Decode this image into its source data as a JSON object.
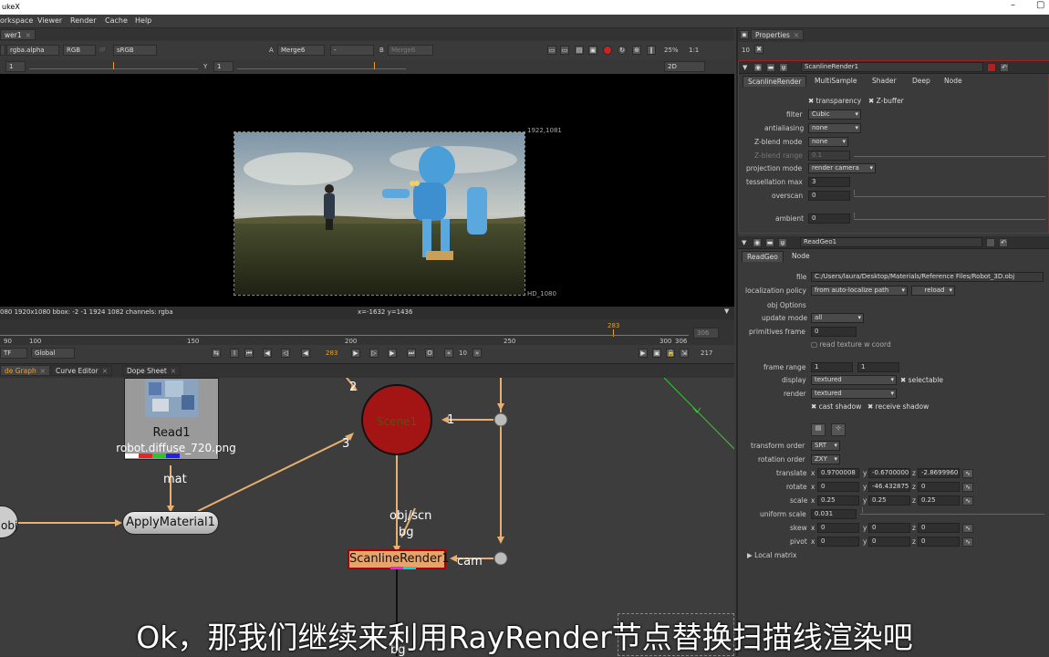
{
  "app": {
    "title": "ukeX"
  },
  "menu": [
    "orkspace",
    "Viewer",
    "Render",
    "Cache",
    "Help"
  ],
  "viewer": {
    "tab": "wer1",
    "channels": "rgba.alpha",
    "rgb": "RGB",
    "ip": "IP",
    "colorspace": "sRGB",
    "a_label": "A",
    "a_input": "Merge6",
    "dash": "-",
    "b_label": "B",
    "b_input": "Merge6",
    "zoom": "25%",
    "ratio": "1:1",
    "view_mode": "2D",
    "y_label": "Y",
    "gain_val": "1",
    "gamma_val": "1",
    "format_top": "1922,1081",
    "format_bottom": "HD_1080",
    "status": "080 1920x1080  bbox: -2 -1 1924 1082 channels: rgba",
    "coords": "x=-1632 y=1436",
    "timeline_ticks": [
      "90",
      "100",
      "150",
      "200",
      "250",
      "300",
      "306"
    ],
    "current_frame_top": "283",
    "end_frame": "306",
    "tf": "TF",
    "global": "Global",
    "current_frame": "283",
    "step": "10",
    "frame_count": "217"
  },
  "nodegraph": {
    "tabs": [
      "de Graph",
      "Curve Editor",
      "Dope Sheet"
    ],
    "nodes": {
      "read_title": "Read1",
      "read_file": "robot.diffuse_720.png",
      "mat_label": "mat",
      "applymaterial": "ApplyMaterial1",
      "obj_label": "obj",
      "scene": "Scene1",
      "scene_in1": "1",
      "scene_in2": "2",
      "scene_in3": "3",
      "objscn": "obj/scn",
      "bg": "bg",
      "scanline": "ScanlineRender1",
      "cam": "cam",
      "bottom_bg": "bg"
    }
  },
  "properties": {
    "tab": "Properties",
    "count": "10",
    "scanline": {
      "name": "ScanlineRender1",
      "tabs": [
        "ScanlineRender",
        "MultiSample",
        "Shader",
        "Deep",
        "Node"
      ],
      "transparency": "transparency",
      "zbuffer": "Z-buffer",
      "filter_label": "filter",
      "filter": "Cubic",
      "antialiasing_label": "antialiasing",
      "antialiasing": "none",
      "zblend_mode_label": "Z-blend mode",
      "zblend_mode": "none",
      "zblend_range_label": "Z-blend range",
      "zblend_range": "0.1",
      "projection_label": "projection mode",
      "projection": "render camera",
      "tessellation_label": "tessellation max",
      "tessellation": "3",
      "overscan_label": "overscan",
      "overscan": "0",
      "ambient_label": "ambient",
      "ambient": "0"
    },
    "readgeo": {
      "name": "ReadGeo1",
      "tabs": [
        "ReadGeo",
        "Node"
      ],
      "file_label": "file",
      "file": "C:/Users/laura/Desktop/Materials/Reference Files/Robot_3D.obj",
      "localization_label": "localization policy",
      "localization": "from auto-localize path",
      "reload": "reload",
      "obj_options": "obj Options",
      "update_label": "update mode",
      "update": "all",
      "prim_label": "primitives frame",
      "prim": "0",
      "read_texture": "read texture w coord",
      "frame_range_label": "frame range",
      "frame_range_a": "1",
      "frame_range_b": "1",
      "display_label": "display",
      "display": "textured",
      "selectable": "selectable",
      "render_label": "render",
      "render": "textured",
      "cast_shadow": "cast shadow",
      "receive_shadow": "receive shadow",
      "transform_order_label": "transform order",
      "transform_order": "SRT",
      "rotation_order_label": "rotation order",
      "rotation_order": "ZXY",
      "translate_label": "translate",
      "translate": {
        "x": "0.9700008",
        "y": "-0.6700000",
        "z": "-2.8699960"
      },
      "rotate_label": "rotate",
      "rotate": {
        "x": "0",
        "y": "-46.432875",
        "z": "0"
      },
      "scale_label": "scale",
      "scale": {
        "x": "0.25",
        "y": "0.25",
        "z": "0.25"
      },
      "uniform_label": "uniform scale",
      "uniform": "0.031",
      "skew_label": "skew",
      "skew": {
        "x": "0",
        "y": "0",
        "z": "0"
      },
      "pivot_label": "pivot",
      "pivot": {
        "x": "0",
        "y": "0",
        "z": "0"
      },
      "local_matrix": "Local matrix"
    }
  },
  "subtitle": "Ok，那我们继续来利用RayRender节点替换扫描线渲染吧"
}
